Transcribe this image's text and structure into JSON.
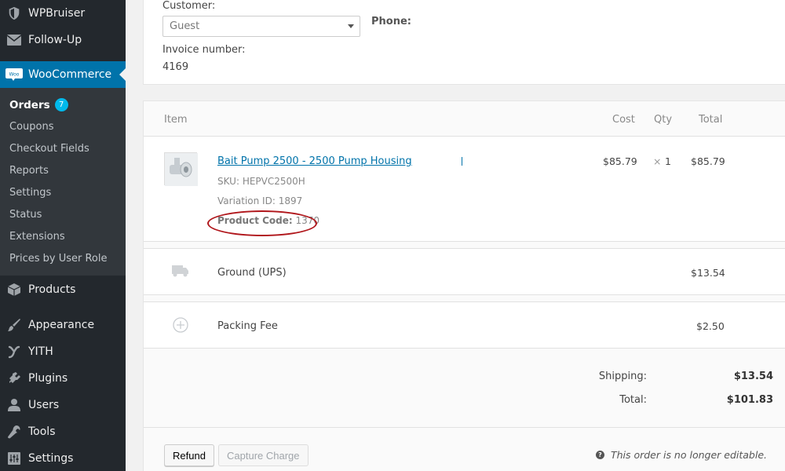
{
  "sidebar": {
    "top_items": [
      {
        "label": "WPBruiser",
        "icon": "shield-icon"
      },
      {
        "label": "Follow-Up",
        "icon": "envelope-icon"
      }
    ],
    "active": {
      "label": "WooCommerce",
      "icon": "woo-icon",
      "icon_text": "Woo"
    },
    "submenu": [
      {
        "label": "Orders",
        "badge": "7"
      },
      {
        "label": "Coupons"
      },
      {
        "label": "Checkout Fields"
      },
      {
        "label": "Reports"
      },
      {
        "label": "Settings"
      },
      {
        "label": "Status"
      },
      {
        "label": "Extensions"
      },
      {
        "label": "Prices by User Role"
      }
    ],
    "bottom_items": [
      {
        "label": "Products",
        "icon": "box-icon"
      },
      {
        "label": "Appearance",
        "icon": "paintbrush-icon"
      },
      {
        "label": "YITH",
        "icon": "yith-icon"
      },
      {
        "label": "Plugins",
        "icon": "plug-icon"
      },
      {
        "label": "Users",
        "icon": "user-icon"
      },
      {
        "label": "Tools",
        "icon": "wrench-icon"
      },
      {
        "label": "Settings",
        "icon": "sliders-icon"
      }
    ]
  },
  "order": {
    "customer_label": "Customer:",
    "customer_value": "Guest",
    "phone_label": "Phone:",
    "invoice_label": "Invoice number:",
    "invoice_value": "4169"
  },
  "items_table": {
    "headers": {
      "item": "Item",
      "cost": "Cost",
      "qty": "Qty",
      "total": "Total"
    },
    "product": {
      "name": "Bait Pump 2500 - 2500 Pump Housing",
      "sku_label": "SKU:",
      "sku": "HEPVC2500H",
      "variation_label": "Variation ID:",
      "variation_id": "1897",
      "code_label": "Product Code:",
      "code": "1370",
      "cost": "$85.79",
      "qty_prefix": "×",
      "qty": "1",
      "total": "$85.79"
    },
    "shipping_line": {
      "label": "Ground (UPS)",
      "total": "$13.54",
      "icon": "truck-icon"
    },
    "fee_line": {
      "label": "Packing Fee",
      "total": "$2.50",
      "icon": "plus-circle-icon"
    }
  },
  "totals": {
    "shipping_label": "Shipping:",
    "shipping_value": "$13.54",
    "total_label": "Total:",
    "total_value": "$101.83"
  },
  "actions": {
    "refund_label": "Refund",
    "capture_label": "Capture Charge",
    "note": "This order is no longer editable."
  },
  "colors": {
    "sidebar_bg": "#23282d",
    "submenu_bg": "#32373c",
    "accent": "#0073aa",
    "badge": "#00b9eb",
    "highlight_oval": "#b0161b"
  }
}
